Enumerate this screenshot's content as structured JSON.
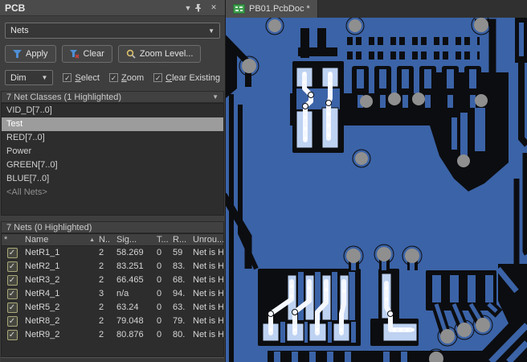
{
  "panel": {
    "title": "PCB",
    "titlebar": {
      "dropdown_icon": "chevron-down-icon",
      "pin_icon": "pin-icon",
      "close_icon": "close-icon"
    },
    "mode_combo": {
      "value": "Nets"
    },
    "toolbar": {
      "apply_label": "Apply",
      "clear_label": "Clear",
      "zoom_level_label": "Zoom Level..."
    },
    "options": {
      "dim_value": "Dim",
      "select_label": "Select",
      "zoom_label": "Zoom",
      "clear_existing_label": "Clear Existing",
      "select_checked": "✓",
      "zoom_checked": "✓",
      "clear_existing_checked": "✓"
    },
    "net_classes": {
      "header": "7 Net Classes (1 Highlighted)",
      "items": [
        {
          "label": "VID_D[7..0]",
          "selected": false,
          "dim": false
        },
        {
          "label": "Test",
          "selected": true,
          "dim": false
        },
        {
          "label": "RED[7..0]",
          "selected": false,
          "dim": false
        },
        {
          "label": "Power",
          "selected": false,
          "dim": false
        },
        {
          "label": "GREEN[7..0]",
          "selected": false,
          "dim": false
        },
        {
          "label": "BLUE[7..0]",
          "selected": false,
          "dim": false
        },
        {
          "label": "<All Nets>",
          "selected": false,
          "dim": true
        }
      ]
    },
    "nets": {
      "header": "7 Nets (0 Highlighted)",
      "columns": {
        "check": "*",
        "name": "Name",
        "nodes": "N..",
        "signal": "Sig...",
        "t": "T...",
        "routed": "R...",
        "unrouted": "Unrou..."
      },
      "rows": [
        {
          "checked": "✓",
          "name": "NetR1_1",
          "nodes": "2",
          "signal": "58.269",
          "t": "0",
          "routed": "59",
          "unrouted": "Net is Hid"
        },
        {
          "checked": "✓",
          "name": "NetR2_1",
          "nodes": "2",
          "signal": "83.251",
          "t": "0",
          "routed": "83.",
          "unrouted": "Net is Hid"
        },
        {
          "checked": "✓",
          "name": "NetR3_2",
          "nodes": "2",
          "signal": "66.465",
          "t": "0",
          "routed": "68.",
          "unrouted": "Net is Hid"
        },
        {
          "checked": "✓",
          "name": "NetR4_1",
          "nodes": "3",
          "signal": "n/a",
          "t": "0",
          "routed": "94.",
          "unrouted": "Net is Hid"
        },
        {
          "checked": "✓",
          "name": "NetR5_2",
          "nodes": "2",
          "signal": "63.24",
          "t": "0",
          "routed": "63.",
          "unrouted": "Net is Hid"
        },
        {
          "checked": "✓",
          "name": "NetR8_2",
          "nodes": "2",
          "signal": "79.048",
          "t": "0",
          "routed": "79.",
          "unrouted": "Net is Hid"
        },
        {
          "checked": "✓",
          "name": "NetR9_2",
          "nodes": "2",
          "signal": "80.876",
          "t": "0",
          "routed": "80.",
          "unrouted": "Net is Hid"
        }
      ]
    }
  },
  "editor": {
    "tab_label": "PB01.PcbDoc *"
  },
  "colors": {
    "board_copper_blue": "#3b63a7",
    "board_clearance_black": "#0c0d10",
    "via_gray": "#8f8f8f",
    "highlight_pad": "#bed2f2",
    "highlight_trace": "#f5f8ff",
    "selection_gray": "#9c9c9c",
    "checkbox_accent": "#a8a878",
    "doc_icon_green": "#3f9f4f"
  }
}
